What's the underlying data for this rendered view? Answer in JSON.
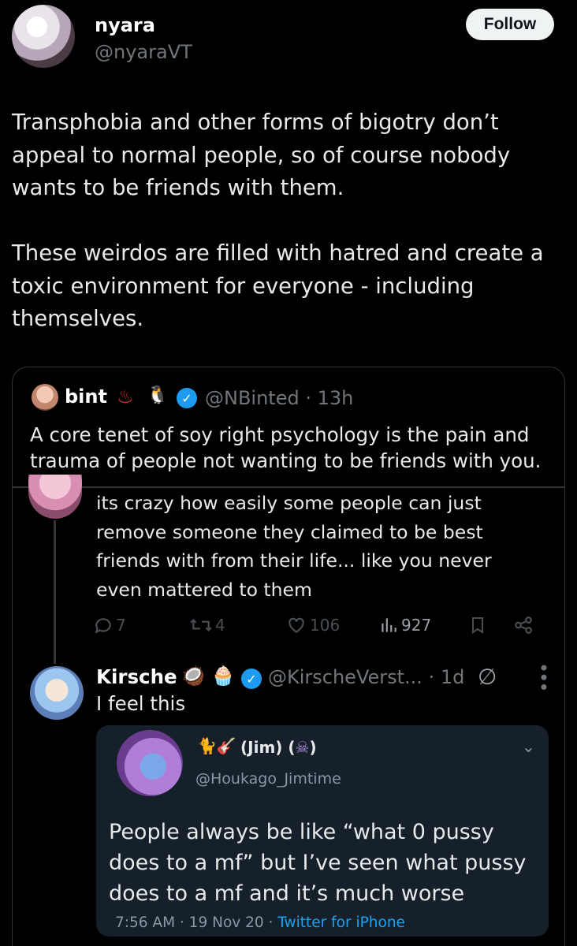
{
  "author": {
    "display_name": "nyara",
    "handle": "@nyaraVT",
    "follow_label": "Follow"
  },
  "tweet": {
    "paragraph1_lines": [
      "Transphobia and other forms of bigotry don’t",
      "appeal to normal people, so of course nobody",
      "wants to be friends with them."
    ],
    "paragraph2_lines": [
      "These weirdos are filled with hatred and create a",
      "toxic environment for everyone - including",
      "themselves."
    ]
  },
  "quote": {
    "name": "bint",
    "emoji_hot_springs": "♨",
    "emoji_penguin": "🐧",
    "meta": "@NBinted · 13h",
    "text_lines": [
      "A core tenet of soy right psychology is the pain and",
      "trauma of people not wanting to be friends with you."
    ]
  },
  "reply": {
    "text_lines": [
      "its crazy how easily some people can just",
      "remove someone they claimed to be best",
      "friends with from their life... like you never",
      "even mattered to them"
    ],
    "actions": {
      "replies": "7",
      "retweets": "4",
      "likes": "106",
      "views": "927"
    }
  },
  "kirsche": {
    "name": "Kirsche",
    "emoji_coconut": "🥥",
    "emoji_cupcake": "🧁",
    "meta": "@KirscheVerst... · 1d",
    "text": "I feel this",
    "embedded": {
      "name": "(Jim) (",
      "handle": "@Houkago_Jimtime",
      "text_lines": [
        "People always be like “what 0 pussy",
        "does to a mf” but I’ve seen what pussy",
        "does to a mf and it’s much worse"
      ],
      "timestamp": "7:56 AM · 19 Nov 20 · ",
      "source": "Twitter for iPhone"
    }
  }
}
